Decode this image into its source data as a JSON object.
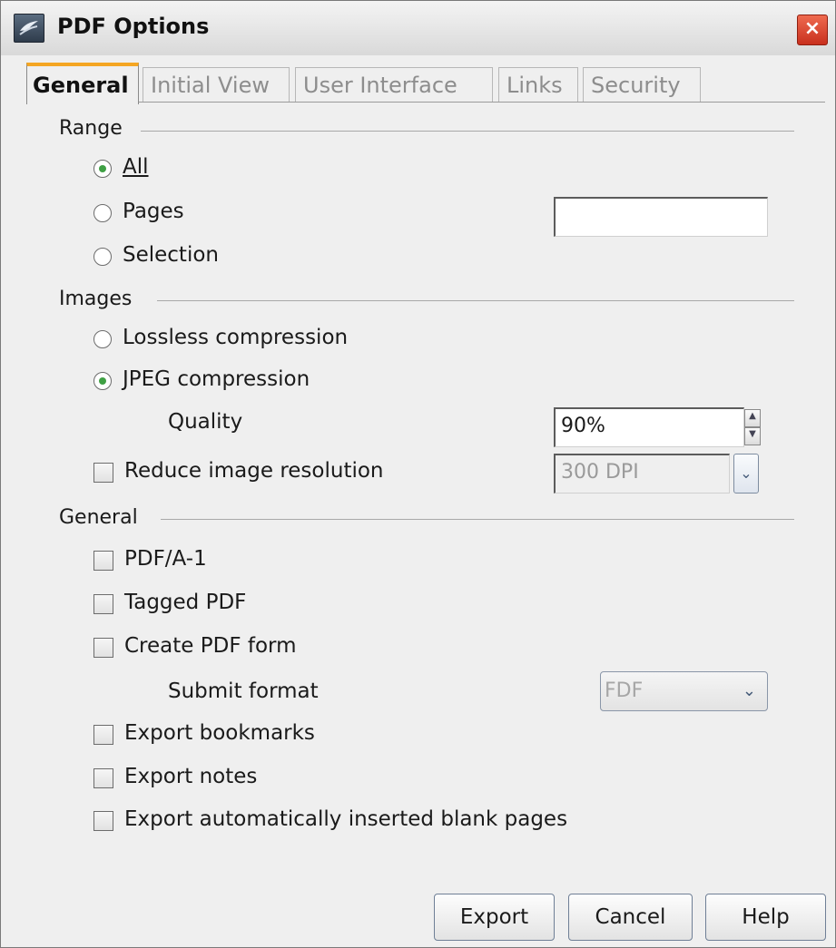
{
  "window": {
    "title": "PDF Options",
    "close_label": "×"
  },
  "tabs": [
    {
      "label": "General"
    },
    {
      "label": "Initial View"
    },
    {
      "label": "User Interface"
    },
    {
      "label": "Links"
    },
    {
      "label": "Security"
    }
  ],
  "range": {
    "heading": "Range",
    "all_label": "All",
    "pages_label": "Pages",
    "selection_label": "Selection",
    "selected": "All",
    "pages_value": ""
  },
  "images": {
    "heading": "Images",
    "lossless_label": "Lossless compression",
    "jpeg_label": "JPEG compression",
    "selected": "JPEG compression",
    "quality_label": "Quality",
    "quality_value": "90%",
    "reduce_label": "Reduce image resolution",
    "reduce_checked": false,
    "resolution_value": "300 DPI"
  },
  "general": {
    "heading": "General",
    "pdfa_label": "PDF/A-1",
    "tagged_label": "Tagged PDF",
    "create_form_label": "Create PDF form",
    "submit_format_label": "Submit format",
    "submit_format_value": "FDF",
    "bookmarks_label": "Export bookmarks",
    "notes_label": "Export notes",
    "blank_pages_label": "Export automatically inserted blank pages"
  },
  "buttons": {
    "export": "Export",
    "cancel": "Cancel",
    "help": "Help"
  },
  "colors": {
    "tab_accent": "#f5a623",
    "radio_selected": "#3fa044",
    "close_button": "#d8402a"
  },
  "icons": {
    "app": "document-icon",
    "close": "close-icon",
    "spin": "spin-arrows-icon",
    "dropdown": "chevron-down-icon"
  }
}
